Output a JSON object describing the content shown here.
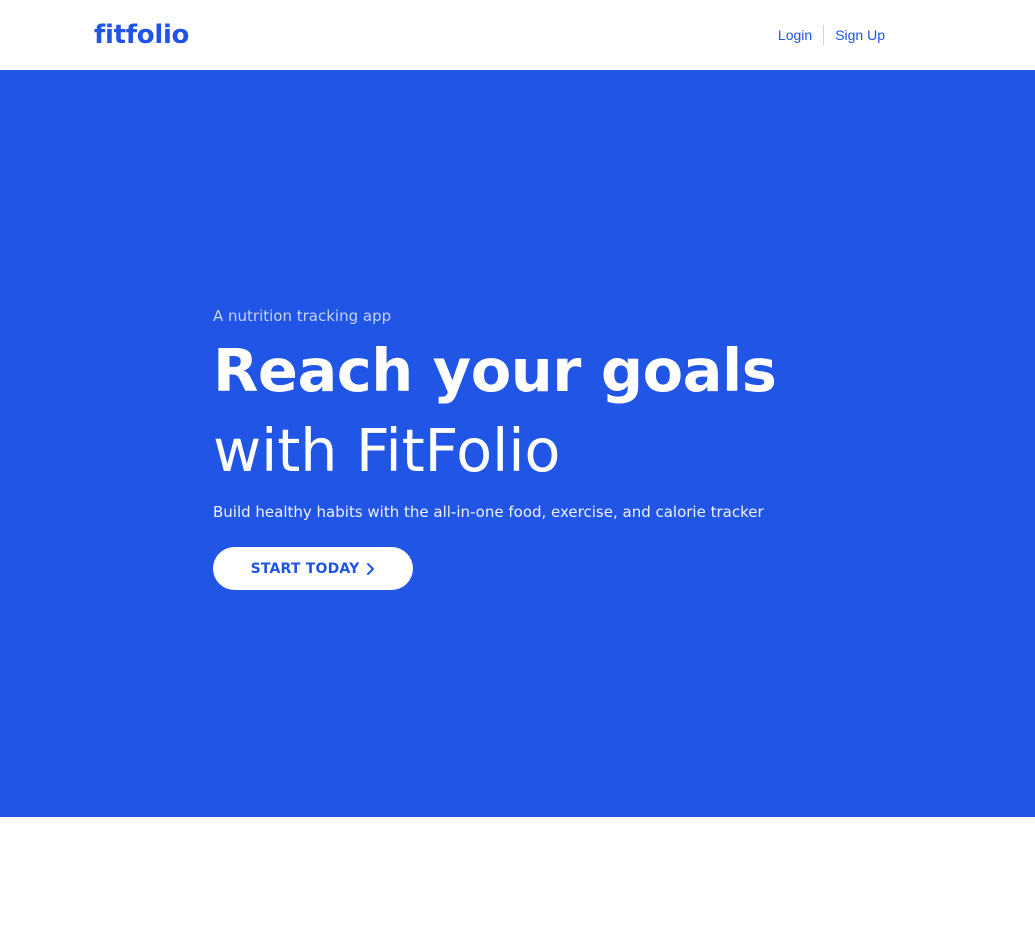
{
  "nav": {
    "brand": "fitfolio",
    "login": "Login",
    "signup": "Sign Up"
  },
  "hero": {
    "eyebrow": "A nutrition tracking app",
    "headline_line1": "Reach your goals",
    "headline_line2": "with FitFolio",
    "subtitle": "Build healthy habits with the all-in-one food, exercise, and calorie tracker",
    "cta_label": "START TODAY",
    "cta_icon": "chevron-right-icon"
  },
  "colors": {
    "brand": "#1f54e5",
    "hero_bg": "#2055e5",
    "white": "#ffffff"
  }
}
